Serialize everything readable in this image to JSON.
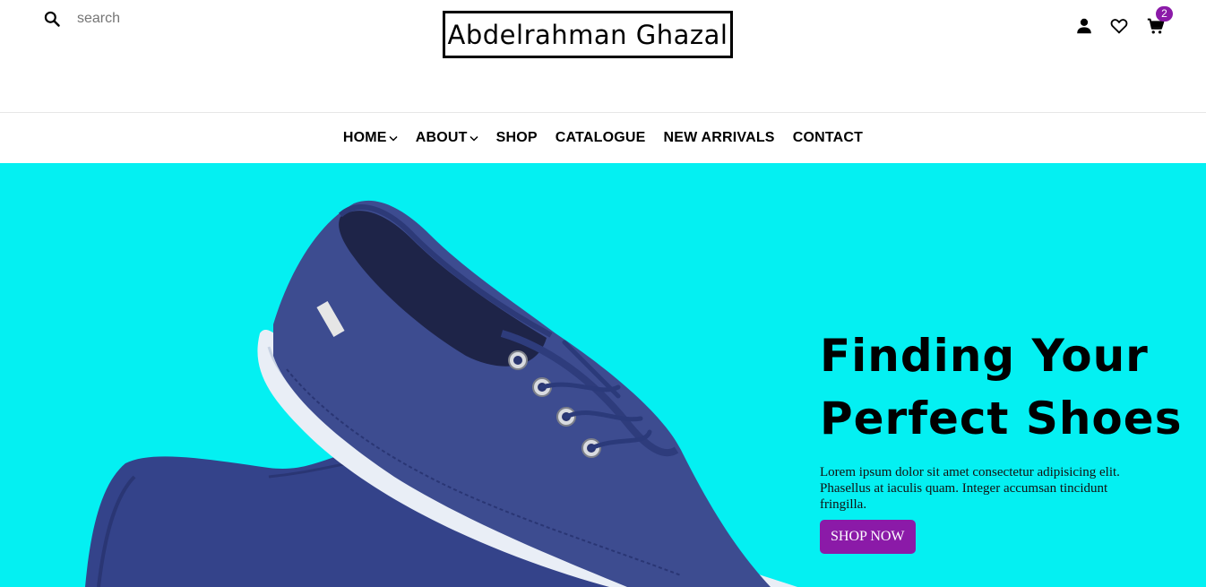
{
  "header": {
    "search": {
      "placeholder": "search",
      "value": "",
      "icon": "search-icon"
    },
    "logo": "Abdelrahman Ghazal",
    "icons": [
      "user-icon",
      "heart-icon",
      "cart-icon"
    ],
    "cart_count": "2"
  },
  "nav": {
    "items": [
      {
        "label": "HOME",
        "dropdown": true
      },
      {
        "label": "ABOUT",
        "dropdown": true
      },
      {
        "label": "SHOP",
        "dropdown": false
      },
      {
        "label": "CATALOGUE",
        "dropdown": false
      },
      {
        "label": "NEW ARRIVALS",
        "dropdown": false
      },
      {
        "label": "CONTACT",
        "dropdown": false
      }
    ]
  },
  "hero": {
    "title_line1": "Finding Your",
    "title_line2": "Perfect Shoes",
    "description": "Lorem ipsum dolor sit amet consectetur adipisicing elit. Phasellus at iaculis quam. Integer accumsan tincidunt fringilla.",
    "cta_label": "SHOP NOW"
  },
  "colors": {
    "hero_bg": "#04f0f2",
    "accent": "#8b1aa8",
    "shoe": "#3b4a8c"
  }
}
